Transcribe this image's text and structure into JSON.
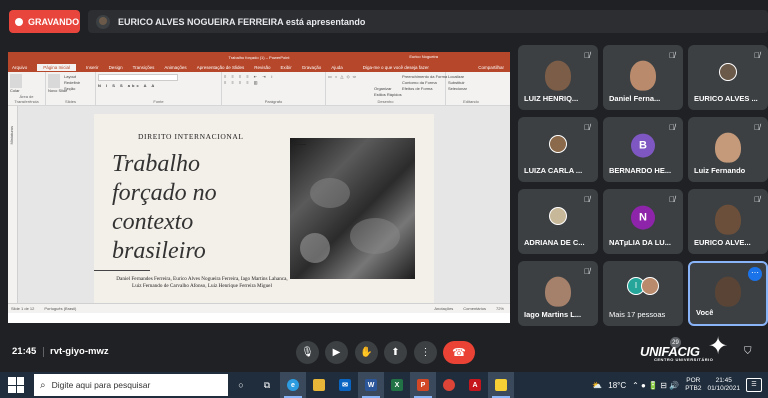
{
  "meet": {
    "recording_label": "GRAVANDO",
    "presenter_text": "EURICO ALVES NOGUEIRA FERREIRA está apresentando",
    "time": "21:45",
    "meeting_code": "rvt-giyo-mwz",
    "participant_count": "29",
    "brand": "UNIFACIG",
    "brand_sub": "CENTRO UNIVERSITÁRIO"
  },
  "powerpoint": {
    "window_title": "Trabalho forçado (1) – PowerPoint",
    "user_name": "Eurico Nogueira",
    "tabs": [
      "Arquivo",
      "Página Inicial",
      "Inserir",
      "Design",
      "Transições",
      "Animações",
      "Apresentação de Slides",
      "Revisão",
      "Exibir",
      "Gravação",
      "Ajuda"
    ],
    "tell_me": "Diga-me o que você deseja fazer",
    "share_label": "Compartilhar",
    "ribbon": {
      "groups": [
        "Área de Transferência",
        "Slides",
        "Fonte",
        "Parágrafo",
        "Desenho",
        "Editando"
      ],
      "paste": "Colar",
      "new_slide": "Novo Slide",
      "layout": "Layout",
      "reset": "Redefinir",
      "section": "Seção",
      "arrange": "Organizar",
      "quick_styles": "Estilos Rápidos",
      "shape_fill": "Preenchimento da Forma",
      "shape_outline": "Contorno da Forma",
      "shape_effects": "Efeitos de Forma",
      "find": "Localizar",
      "replace": "Substituir",
      "select": "Selecionar"
    },
    "thumbnails_label": "Miniaturas",
    "status": {
      "slide_count": "Slide 1 de 12",
      "language": "Português (Brasil)",
      "notes": "Anotações",
      "comments": "Comentários",
      "zoom": "72%"
    },
    "slide": {
      "kicker": "DIREITO INTERNACIONAL",
      "title_lines": [
        "Trabalho",
        "forçado no",
        "contexto",
        "brasileiro"
      ],
      "authors": "Daniel Fernandes Ferreira, Eurico Alves Nogueira Ferreira, Iago Martins Lahanca, Luiz Fernando de Carvalho Afonso, Luiz Henrique Ferreira Miguel"
    }
  },
  "participants": [
    {
      "name": "LUIZ HENRIQ...",
      "type": "photo",
      "tone": "#7b5d48"
    },
    {
      "name": "Daniel Ferna...",
      "type": "photo",
      "tone": "#b98a6c"
    },
    {
      "name": "EURICO ALVES ...",
      "type": "mini",
      "tone": "#6b5a4a"
    },
    {
      "name": "LUIZA CARLA ...",
      "type": "mini",
      "tone": "#8a6a4a"
    },
    {
      "name": "BERNARDO HE...",
      "type": "letter",
      "letter": "B",
      "color": "#7e57c2"
    },
    {
      "name": "Luiz Fernando",
      "type": "photo",
      "tone": "#c49a7a"
    },
    {
      "name": "ADRIANA DE C...",
      "type": "mini",
      "tone": "#c8b89a"
    },
    {
      "name": "NATµLIA DA LU...",
      "type": "letter",
      "letter": "N",
      "color": "#8e24aa"
    },
    {
      "name": "EURICO ALVE...",
      "type": "photo",
      "tone": "#6b4f3a"
    },
    {
      "name": "Iago Martins L...",
      "type": "photo",
      "tone": "#a5806a"
    },
    {
      "name": "Mais 17 pessoas",
      "type": "group",
      "letter": "I"
    },
    {
      "name": "Você",
      "type": "photo",
      "tone": "#5a4436",
      "me": true
    }
  ],
  "taskbar": {
    "search_placeholder": "Digite aqui para pesquisar",
    "weather": "18°C",
    "lang_top": "POR",
    "lang_bottom": "PTB2",
    "clock_time": "21:45",
    "clock_date": "01/10/2021"
  }
}
